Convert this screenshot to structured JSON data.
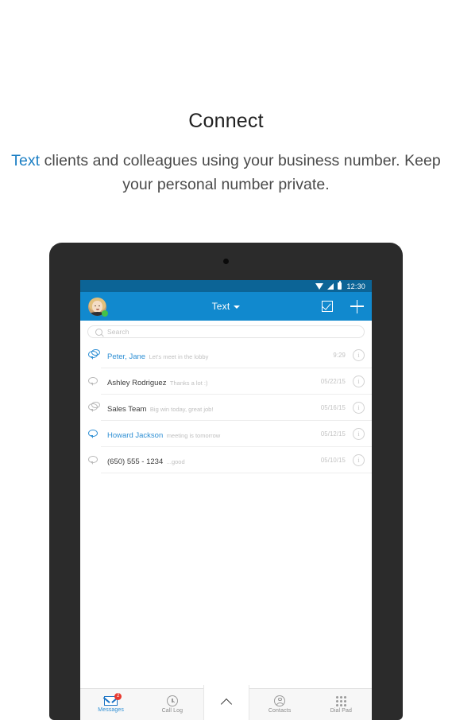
{
  "promo": {
    "title": "Connect",
    "subtitle_highlight": "Text",
    "subtitle_rest": " clients and colleagues using your business number. Keep your personal number private.",
    "accent_color": "#1c7fc4"
  },
  "device": {
    "status_bar": {
      "time": "12:30",
      "wifi_icon": "wifi-icon",
      "signal_icon": "signal-icon",
      "battery_icon": "battery-icon",
      "background": "#0c6496"
    },
    "app_bar": {
      "background": "#1189ce",
      "avatar_icon": "avatar",
      "presence_status": "online",
      "presence_color": "#44c14a",
      "title": "Text",
      "dropdown_icon": "chevron-down-icon",
      "compose_icon": "checkbox-compose-icon",
      "add_icon": "plus-icon"
    },
    "search": {
      "placeholder": "Search",
      "icon": "search-icon"
    },
    "conversations": [
      {
        "name": "Peter, Jane",
        "snippet": "Let's meet in the lobby",
        "time": "9:29",
        "unread": true,
        "icon": "chat-bubbles-icon",
        "info_label": "i"
      },
      {
        "name": "Ashley Rodriguez",
        "snippet": "Thanks a lot :)",
        "time": "05/22/15",
        "unread": false,
        "icon": "chat-bubble-icon",
        "info_label": "i"
      },
      {
        "name": "Sales Team",
        "snippet": "Big win today, great job!",
        "time": "05/16/15",
        "unread": false,
        "icon": "chat-bubbles-icon",
        "info_label": "i"
      },
      {
        "name": "Howard Jackson",
        "snippet": "meeting is tomorrow",
        "time": "05/12/15",
        "unread": true,
        "icon": "chat-bubble-icon",
        "info_label": "i"
      },
      {
        "name": "(650) 555 - 1234",
        "snippet": "...good",
        "time": "05/10/15",
        "unread": false,
        "icon": "chat-bubble-icon",
        "info_label": "i"
      }
    ],
    "bottom_nav": {
      "messages": {
        "label": "Messages",
        "icon": "envelope-icon",
        "badge": "2",
        "badge_color": "#e8392f",
        "active": true
      },
      "call_log": {
        "label": "Call Log",
        "icon": "clock-icon",
        "active": false
      },
      "expand": {
        "icon": "chevron-up-icon"
      },
      "contacts": {
        "label": "Contacts",
        "icon": "person-icon",
        "active": false
      },
      "dial_pad": {
        "label": "Dial Pad",
        "icon": "dialpad-grid-icon",
        "active": false
      }
    }
  }
}
